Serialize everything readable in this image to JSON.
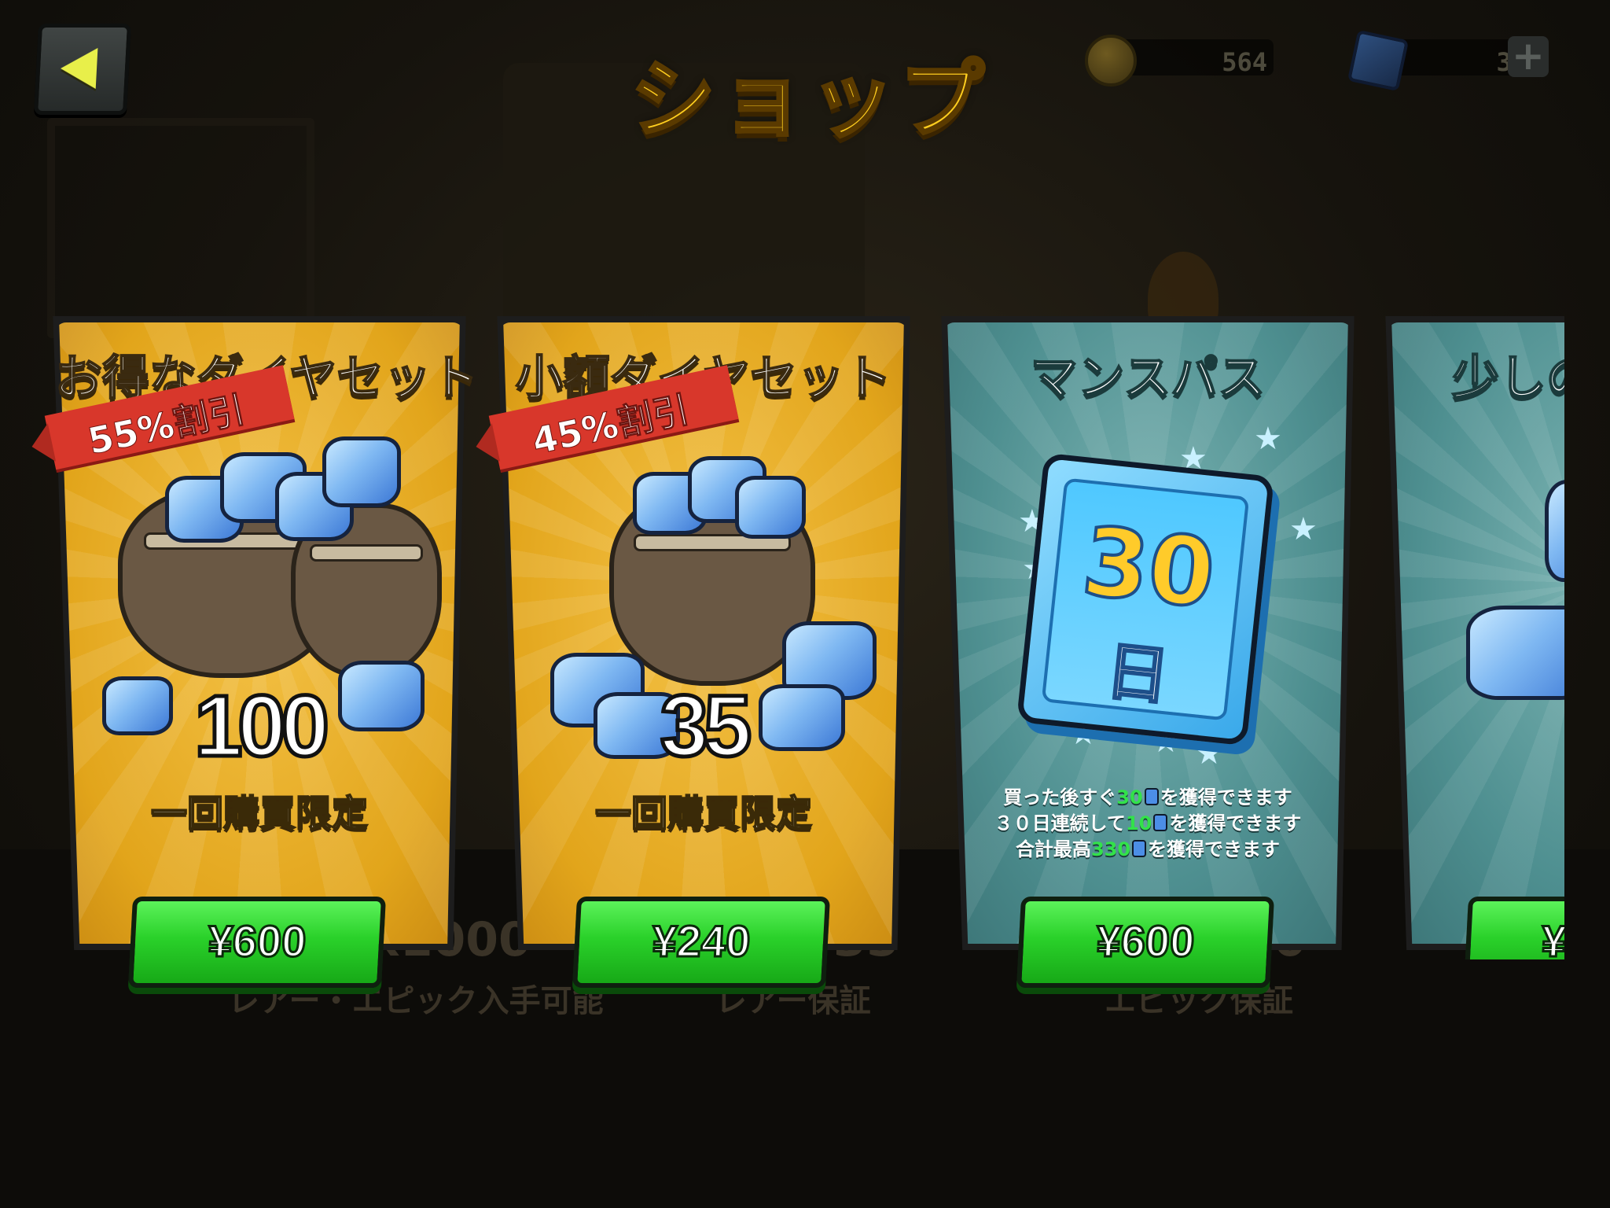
{
  "header": {
    "title": "ショップ",
    "back_label": "",
    "coins": "564",
    "gems": "33",
    "plus": "+"
  },
  "cards": [
    {
      "name": "お得なダイヤセット",
      "discount": "55%割引",
      "amount": "100",
      "limit": "一回購買限定",
      "price": "¥600"
    },
    {
      "name": "小額ダイヤセット",
      "discount": "45%割引",
      "amount": "35",
      "limit": "一回購買限定",
      "price": "¥240"
    },
    {
      "name": "マンスパス",
      "days_num": "30",
      "days_unit": "日",
      "desc": [
        {
          "pre": "買った後すぐ",
          "hl": "30",
          "post": "を獲得できます"
        },
        {
          "pre": "３０日連続して",
          "hl": "10",
          "post": "を獲得できます"
        },
        {
          "pre": "合計最高",
          "hl": "330",
          "post": "を獲得できます"
        }
      ],
      "price": "¥600"
    },
    {
      "name": "少しの",
      "price": "¥"
    }
  ],
  "background_text": {
    "amount_1": "x1000",
    "label_1": "レアー・エピック入手可能",
    "amount_2": "35",
    "label_2": "レアー保証",
    "amount_3": "0",
    "label_3": "エピック保証"
  },
  "colors": {
    "title": "#ffce1f",
    "gold_card": "#e2a51b",
    "teal_card": "#4e8f90",
    "button_green": "#2ad12a",
    "ribbon_red": "#d8372b",
    "highlight_green": "#32e24a"
  }
}
